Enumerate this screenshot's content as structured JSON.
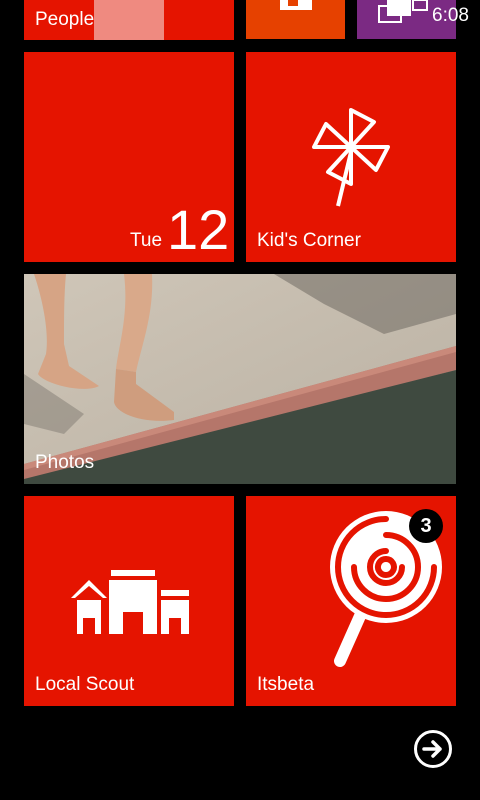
{
  "status_bar": {
    "time": "6:08"
  },
  "tiles": {
    "people": {
      "label": "People"
    },
    "calendar": {
      "day": "Tue",
      "date": "12"
    },
    "kids_corner": {
      "label": "Kid's Corner"
    },
    "photos": {
      "label": "Photos"
    },
    "local_scout": {
      "label": "Local Scout"
    },
    "itsbeta": {
      "label": "Itsbeta",
      "badge": "3"
    }
  },
  "icons": {
    "office": "office-icon",
    "messaging": "messaging-icon",
    "pinwheel": "pinwheel-icon",
    "buildings": "buildings-icon",
    "lollipop": "lollipop-icon",
    "arrow": "arrow-right-icon"
  },
  "colors": {
    "accent": "#e51400",
    "purple_tile": "#7b2a83",
    "orange_tile": "#e64100"
  }
}
